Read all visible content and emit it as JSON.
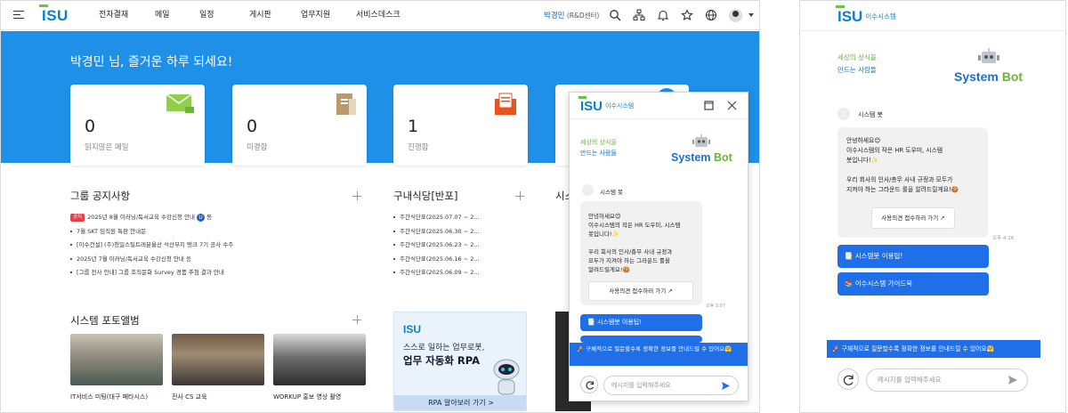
{
  "topbar": {
    "logo": "ISU",
    "nav": [
      "전자결재",
      "메일",
      "일정",
      "게시판",
      "업무지원",
      "서비스데스크"
    ],
    "user_name": "박경민",
    "user_dept": " (R&D센터)"
  },
  "hero": {
    "greeting": "박경민 님, 즐거운 하루 되세요!"
  },
  "cards": [
    {
      "count": "0",
      "label": "읽지않은 메일",
      "icon": "envelope-icon"
    },
    {
      "count": "0",
      "label": "미결함",
      "icon": "folder-icon"
    },
    {
      "count": "1",
      "label": "진행함",
      "icon": "document-icon"
    }
  ],
  "notice": {
    "title": "그룹 공지사항",
    "hot_badge": "공지",
    "u_badge": "U",
    "items": [
      "2025년 8월 이러닝/독서교육 수강신청 안내",
      "7월 SKT 임직원 특판 안내문",
      "[이수건설] (주)청일스틸트레분울산 석산부지 탱크 7기 공사 수주",
      "2025년 7월 이러닝/독서교육 수강신청 안내",
      "[그룹 전사 안내] 그룹 조직문화 Survey 경품 추첨 결과 안내"
    ],
    "first_suffix": " 등",
    "fourth_suffix": " 응"
  },
  "cafeteria": {
    "title": "구내식당[반포]",
    "items": [
      "주간식단표(2025.07.07 ~ 2...",
      "주간식단표(2025.06.30 ~ 2...",
      "주간식단표(2025.06.23 ~ 2...",
      "주간식단표(2025.06.16 ~ 2...",
      "주간식단표(2025.06.09 ~ 2..."
    ]
  },
  "third_section_partial": "시스",
  "photos": {
    "title": "시스템 포토앨범",
    "items": [
      "IT서비스 미팅(대구 페타시스)",
      "전사 CS 교육",
      "WORKUP 홍보 영상 촬영"
    ]
  },
  "rpa": {
    "logo": "ISU",
    "line1": "스스로 일하는 업무로봇,",
    "line2": "업무 자동화 RPA",
    "button": "RPA 알아보러 가기 >"
  },
  "chat": {
    "logo": "ISU",
    "logo_sub": "이수시스템",
    "slogan1": "세상의 상식을",
    "slogan2": "만드는 사람들",
    "sysbot_a": "System ",
    "sysbot_b": "Bot",
    "bot_name": "시스템 봇",
    "greeting_lines": [
      "안녕하세요😊",
      "이수시스템의 작은 HR 도우미, 시스템",
      "봇입니다!✨",
      "",
      "우리 회사의 인사/총무 사내 규정과",
      "모두가 지켜야 하는 그라운드 룰을",
      "알려드릴게요!🍪"
    ],
    "greeting_lines_full": [
      "안녕하세요😊",
      "이수시스템의 작은 HR 도우미, 시스템",
      "봇입니다!✨",
      "",
      "우리 회사의 인사/총무 사내 규정과 모두가",
      "지켜야 하는 그라운드 룰을 알려드릴게요!🍪"
    ],
    "manual_button": "사용의견 접수하러 가기",
    "time": "오후 3:07",
    "time_full": "오후 4:16",
    "quick1": "📑 시스템봇 이용팁!",
    "quick2": "📚 이수시스템 가이드북",
    "tip": "🚀 구체적으로 질문할수록 정확한 정보를 안내드릴 수 있어요🤗",
    "input_placeholder": "메시지를 입력해주세요"
  },
  "colors": {
    "brand_blue": "#0a7fd0",
    "hero_blue": "#1e90e8",
    "brand_green": "#6cc04a",
    "quick_blue": "#1f6fe8"
  }
}
